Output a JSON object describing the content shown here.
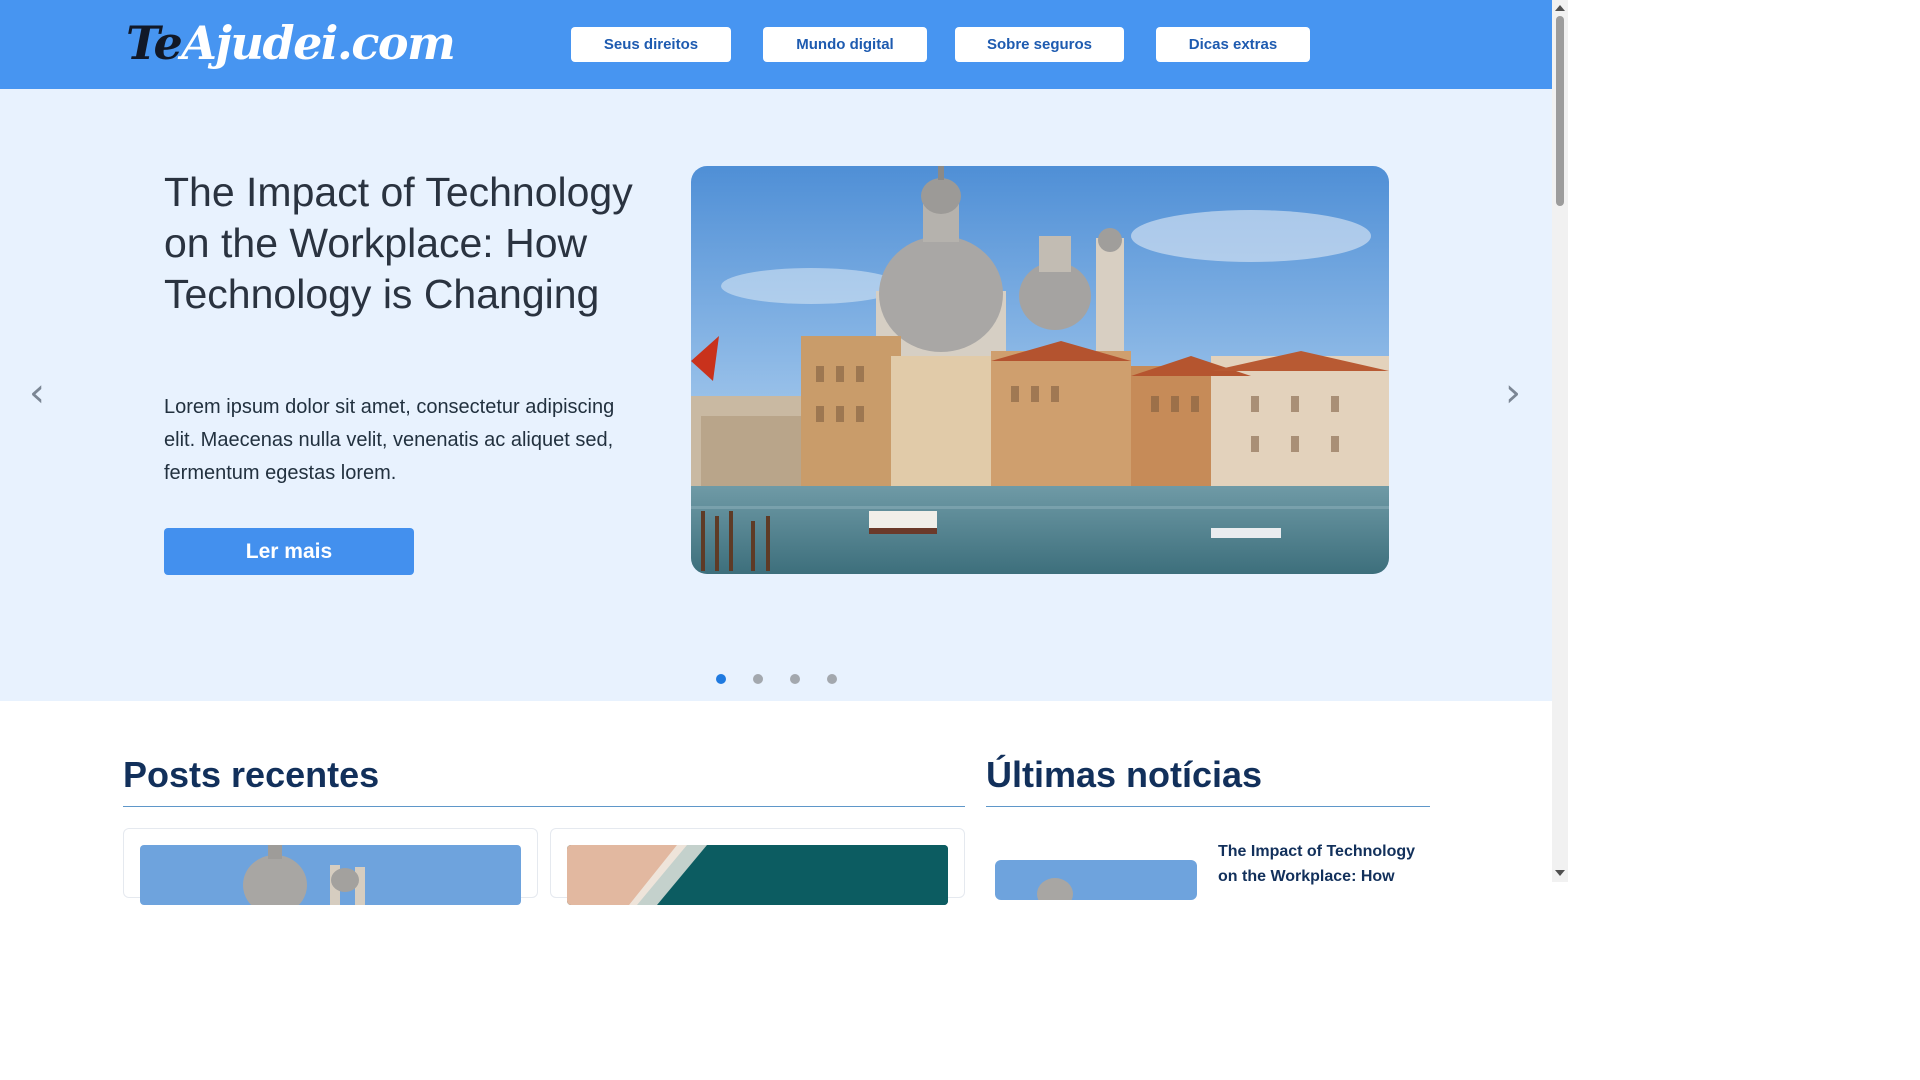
{
  "header": {
    "logo_part1": "Te",
    "logo_part2": "Ajudei.com",
    "nav": [
      "Seus direitos",
      "Mundo digital",
      "Sobre seguros",
      "Dicas extras"
    ]
  },
  "hero": {
    "title": "The Impact of Technology on the Workplace: How Technology is Changing",
    "text": "Lorem ipsum dolor sit amet, consectetur adipiscing elit. Maecenas nulla velit, venenatis ac aliquet sed, fermentum egestas lorem.",
    "button": "Ler mais",
    "prev_icon": "‹",
    "next_icon": "›",
    "active_slide": 1,
    "slide_count": 4
  },
  "posts": {
    "title": "Posts recentes"
  },
  "news": {
    "title": "Últimas notícias",
    "item_title": "The Impact of Technology on the Workplace: How"
  },
  "colors": {
    "header": "#4795f1",
    "hero_bg": "#e8f2fe",
    "accent": "#4390ee",
    "heading": "#12305b"
  }
}
